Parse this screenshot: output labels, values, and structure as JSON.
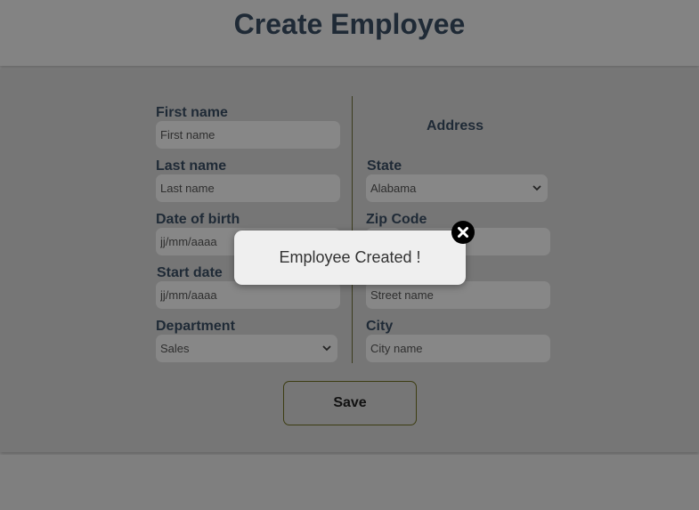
{
  "page": {
    "title": "Create Employee"
  },
  "form": {
    "first_name": {
      "label": "First name",
      "placeholder": "First name"
    },
    "last_name": {
      "label": "Last name",
      "placeholder": "Last name"
    },
    "date_of_birth": {
      "label": "Date of birth",
      "placeholder": "jj/mm/aaaa"
    },
    "start_date": {
      "label": "Start date",
      "placeholder": "jj/mm/aaaa"
    },
    "department": {
      "label": "Department",
      "value": "Sales"
    }
  },
  "address": {
    "title": "Address",
    "state": {
      "label": "State",
      "value": "Alabama"
    },
    "zip_code": {
      "label": "Zip Code",
      "placeholder": ""
    },
    "street": {
      "label": "",
      "placeholder": "Street name"
    },
    "city": {
      "label": "City",
      "placeholder": "City name"
    }
  },
  "actions": {
    "save_label": "Save"
  },
  "modal": {
    "message": "Employee Created !",
    "close_icon": "close-icon"
  },
  "colors": {
    "overlay_bg": "#7f7f7f",
    "title_text": "#1f2a36",
    "modal_bg": "#efefef",
    "close_bg": "#000000"
  }
}
